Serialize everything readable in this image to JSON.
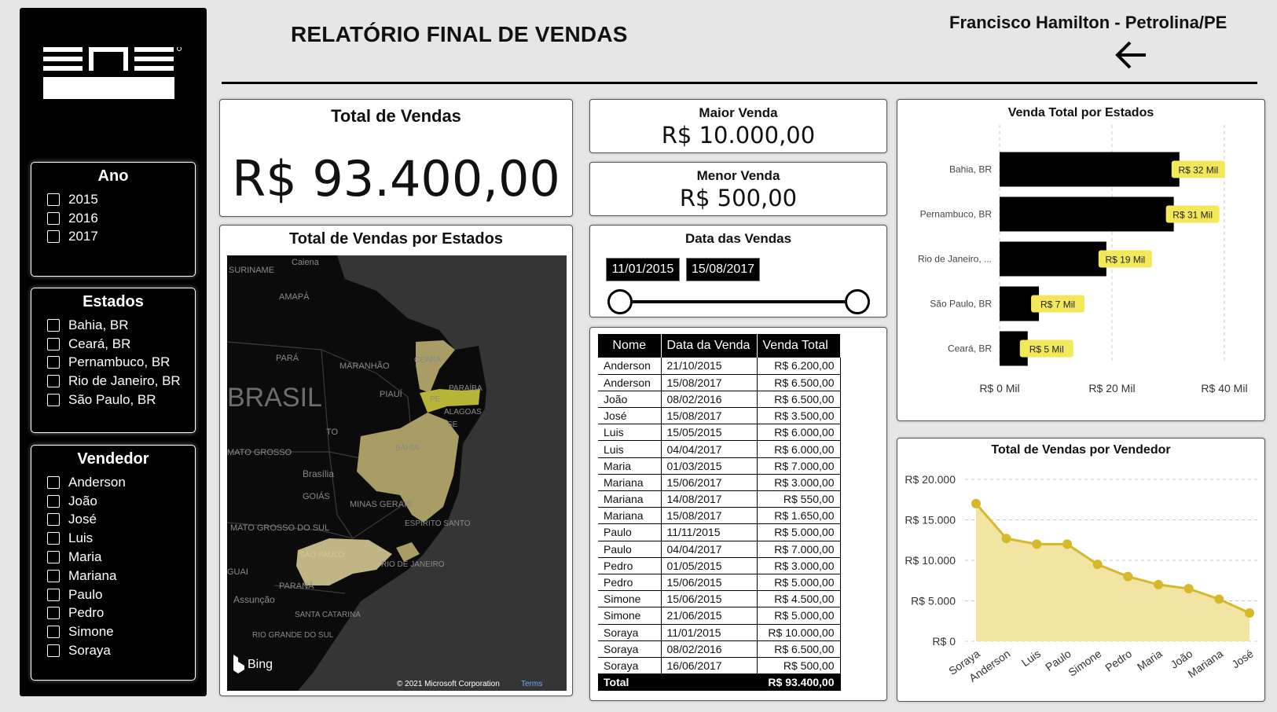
{
  "report": {
    "title": "RELATÓRIO FINAL DE VENDAS",
    "author": "Francisco Hamilton - Petrolina/PE"
  },
  "filters": {
    "ano": {
      "title": "Ano",
      "options": [
        "2015",
        "2016",
        "2017"
      ]
    },
    "estados": {
      "title": "Estados",
      "options": [
        "Bahia, BR",
        "Ceará, BR",
        "Pernambuco, BR",
        "Rio de Janeiro, BR",
        "São Paulo, BR"
      ]
    },
    "vendedor": {
      "title": "Vendedor",
      "options": [
        "Anderson",
        "João",
        "José",
        "Luis",
        "Maria",
        "Mariana",
        "Paulo",
        "Pedro",
        "Simone",
        "Soraya"
      ]
    }
  },
  "kpis": {
    "total": {
      "title": "Total de Vendas",
      "value": "R$ 93.400,00"
    },
    "maior": {
      "title": "Maior Venda",
      "value": "R$ 10.000,00"
    },
    "menor": {
      "title": "Menor Venda",
      "value": "R$ 500,00"
    }
  },
  "date_filter": {
    "title": "Data das Vendas",
    "start": "11/01/2015",
    "end": "15/08/2017"
  },
  "map": {
    "title": "Total de Vendas por Estados",
    "attribution": "© 2021 Microsoft Corporation",
    "terms": "Terms",
    "bing": "Bing",
    "labels": [
      "SURINAME",
      "Caiena",
      "AMAPÁ",
      "PARÁ",
      "MARANHÃO",
      "CEARÁ",
      "PIAUÍ",
      "PARAÍBA",
      "PE",
      "ALAGOAS",
      "SE",
      "BRASIL",
      "TO",
      "BAHIA",
      "MATO GROSSO",
      "Brasília",
      "GOIÁS",
      "MINAS GERAIS",
      "ESPÍRITO SANTO",
      "MATO GROSSO DO SUL",
      "SÃO PAULO",
      "RIO DE JANEIRO",
      "GUAI",
      "PARANÁ",
      "Assunção",
      "SANTA CATARINA",
      "RIO GRANDE DO SUL"
    ]
  },
  "sales_table": {
    "headers": [
      "Nome",
      "Data da Venda",
      "Venda Total"
    ],
    "rows": [
      [
        "Anderson",
        "21/10/2015",
        "R$ 6.200,00"
      ],
      [
        "Anderson",
        "15/08/2017",
        "R$ 6.500,00"
      ],
      [
        "João",
        "08/02/2016",
        "R$ 6.500,00"
      ],
      [
        "José",
        "15/08/2017",
        "R$ 3.500,00"
      ],
      [
        "Luis",
        "15/05/2015",
        "R$ 6.000,00"
      ],
      [
        "Luis",
        "04/04/2017",
        "R$ 6.000,00"
      ],
      [
        "Maria",
        "01/03/2015",
        "R$ 7.000,00"
      ],
      [
        "Mariana",
        "15/06/2017",
        "R$ 3.000,00"
      ],
      [
        "Mariana",
        "14/08/2017",
        "R$ 550,00"
      ],
      [
        "Mariana",
        "15/08/2017",
        "R$ 1.650,00"
      ],
      [
        "Paulo",
        "11/11/2015",
        "R$ 5.000,00"
      ],
      [
        "Paulo",
        "04/04/2017",
        "R$ 7.000,00"
      ],
      [
        "Pedro",
        "01/05/2015",
        "R$ 3.000,00"
      ],
      [
        "Pedro",
        "15/06/2015",
        "R$ 5.000,00"
      ],
      [
        "Simone",
        "15/06/2015",
        "R$ 4.500,00"
      ],
      [
        "Simone",
        "21/06/2015",
        "R$ 5.000,00"
      ],
      [
        "Soraya",
        "11/01/2015",
        "R$ 10.000,00"
      ],
      [
        "Soraya",
        "08/02/2016",
        "R$ 6.500,00"
      ],
      [
        "Soraya",
        "16/06/2017",
        "R$ 500,00"
      ]
    ],
    "total_label": "Total",
    "total_value": "R$ 93.400,00"
  },
  "chart_data": [
    {
      "type": "bar",
      "orientation": "horizontal",
      "title": "Venda Total por Estados",
      "categories": [
        "Bahia, BR",
        "Pernambuco, BR",
        "Rio de Janeiro, ...",
        "São Paulo, BR",
        "Ceará, BR"
      ],
      "values": [
        32,
        31,
        19,
        7,
        5
      ],
      "data_labels": [
        "R$ 32 Mil",
        "R$ 31 Mil",
        "R$ 19 Mil",
        "R$ 7 Mil",
        "R$ 5 Mil"
      ],
      "xlim": [
        0,
        40
      ],
      "xticks": [
        "R$ 0 Mil",
        "R$ 20 Mil",
        "R$ 40 Mil"
      ],
      "bar_color": "#000000",
      "label_color": "#f2e85a",
      "grid": true
    },
    {
      "type": "area",
      "title": "Total de Vendas por Vendedor",
      "categories": [
        "Soraya",
        "Anderson",
        "Luis",
        "Paulo",
        "Simone",
        "Pedro",
        "Maria",
        "João",
        "Mariana",
        "José"
      ],
      "values": [
        17000,
        12700,
        12000,
        12000,
        9500,
        8000,
        7000,
        6500,
        5200,
        3500
      ],
      "ylim": [
        0,
        20000
      ],
      "yticks": [
        "R$ 0",
        "R$ 5.000",
        "R$ 10.000",
        "R$ 15.000",
        "R$ 20.000"
      ],
      "line_color": "#d6b82a",
      "fill_color": "#f2e4a2",
      "grid": true
    }
  ]
}
